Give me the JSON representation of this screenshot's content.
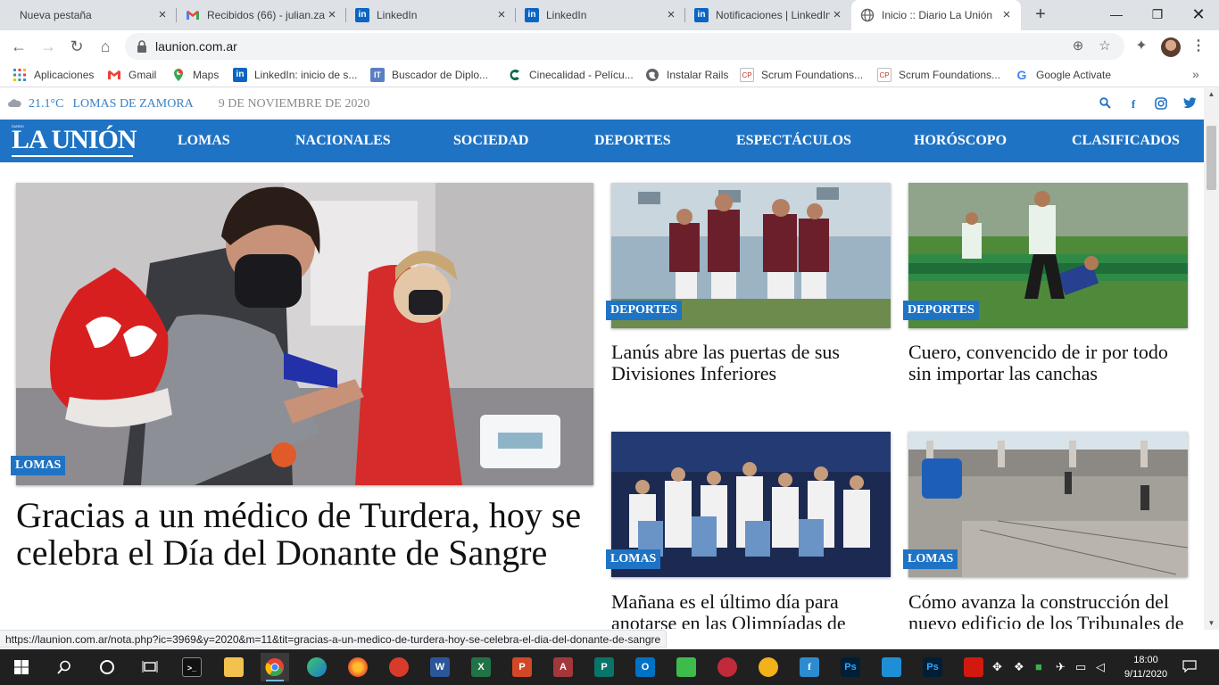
{
  "browser": {
    "tabs": [
      {
        "title": "Nueva pestaña",
        "favicon": "none"
      },
      {
        "title": "Recibidos (66) - julian.za",
        "favicon": "gmail-icon"
      },
      {
        "title": "LinkedIn",
        "favicon": "linkedin-icon"
      },
      {
        "title": "LinkedIn",
        "favicon": "linkedin-icon"
      },
      {
        "title": "Notificaciones | LinkedIn",
        "favicon": "linkedin-icon"
      },
      {
        "title": "Inicio :: Diario La Unión",
        "favicon": "globe-icon"
      }
    ],
    "active_tab_index": 5,
    "url": "launion.com.ar",
    "bookmarks": [
      {
        "label": "Aplicaciones",
        "icon": "apps-grid-icon"
      },
      {
        "label": "Gmail",
        "icon": "gmail-icon"
      },
      {
        "label": "Maps",
        "icon": "maps-pin-icon"
      },
      {
        "label": "LinkedIn: inicio de s...",
        "icon": "linkedin-icon"
      },
      {
        "label": "Buscador de Diplo...",
        "icon": "it-icon"
      },
      {
        "label": "Cinecalidad - Pelícu...",
        "icon": "cinecalidad-icon"
      },
      {
        "label": "Instalar Rails",
        "icon": "globe-icon"
      },
      {
        "label": "Scrum Foundations...",
        "icon": "cp-icon"
      },
      {
        "label": "Scrum Foundations...",
        "icon": "cp-icon"
      },
      {
        "label": "Google Activate",
        "icon": "google-icon"
      }
    ],
    "status_url": "https://launion.com.ar/nota.php?ic=3969&y=2020&m=11&tit=gracias-a-un-medico-de-turdera-hoy-se-celebra-el-dia-del-donante-de-sangre"
  },
  "site": {
    "weather": {
      "temp": "21.1°C",
      "city": "LOMAS DE ZAMORA",
      "date": "9 DE NOVIEMBRE DE 2020"
    },
    "logo": "LA UNIÓN",
    "nav": [
      "LOMAS",
      "NACIONALES",
      "SOCIEDAD",
      "DEPORTES",
      "ESPECTÁCULOS",
      "HORÓSCOPO",
      "CLASIFICADOS"
    ],
    "hero": {
      "tag": "LOMAS",
      "title": "Gracias a un médico de Turdera, hoy se celebra el Día del Donante de Sangre"
    },
    "cards": [
      {
        "tag": "DEPORTES",
        "title": "Lanús abre las puertas de sus Divisiones Inferiores"
      },
      {
        "tag": "DEPORTES",
        "title": "Cuero, convencido de ir por todo sin importar las canchas"
      },
      {
        "tag": "LOMAS",
        "title": "Mañana es el último día para anotarse en las Olimpíadas de Matemática de la UNLZ"
      },
      {
        "tag": "LOMAS",
        "title": "Cómo avanza la construcción del nuevo edificio de los Tribunales de Lomas"
      }
    ],
    "colors": {
      "brand_blue": "#1f73c4",
      "date_gray": "#8a8a8a"
    }
  },
  "taskbar": {
    "time": "18:00",
    "date": "9/11/2020"
  }
}
